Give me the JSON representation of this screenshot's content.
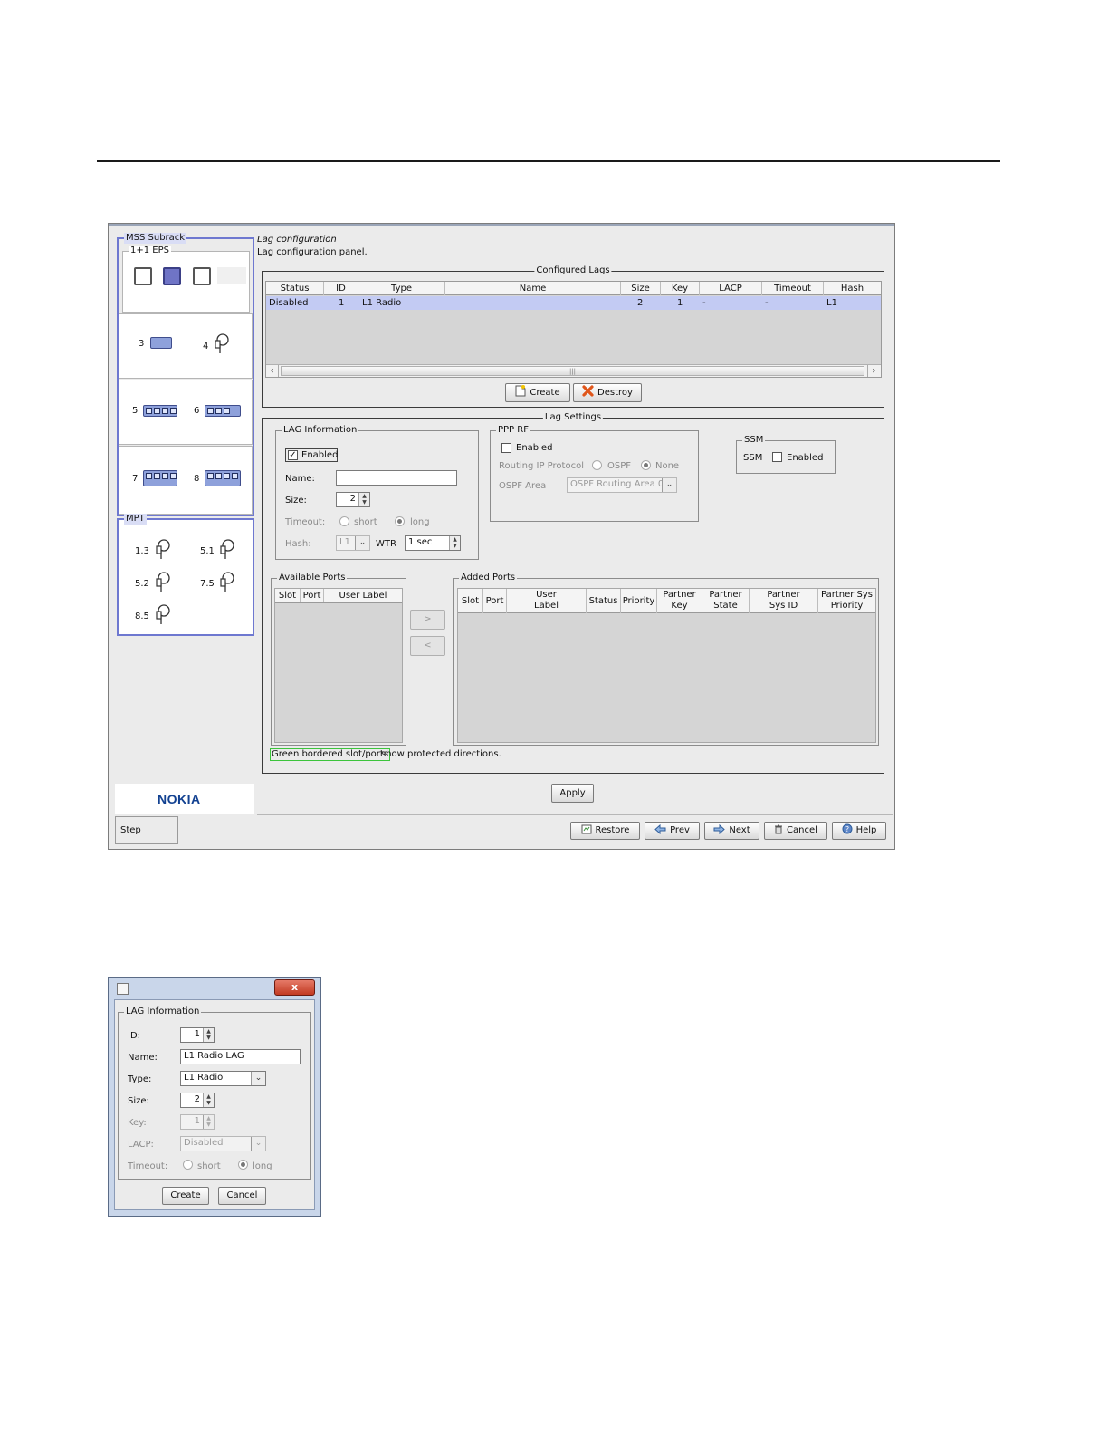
{
  "main_window": {
    "subrack": {
      "title": "MSS Subrack",
      "eps_title": "1+1 EPS",
      "slots_row1": [
        "3",
        "4"
      ],
      "slots_row2": [
        "5",
        "6"
      ],
      "slots_row3": [
        "7",
        "8"
      ]
    },
    "mpt": {
      "title": "MPT",
      "items": [
        "1.3",
        "5.1",
        "5.2",
        "7.5",
        "8.5"
      ]
    },
    "brand": "NOKIA",
    "step_label": "Step",
    "header": {
      "title": "Lag configuration",
      "subtitle": "Lag configuration panel."
    },
    "configured_lags": {
      "title": "Configured Lags",
      "columns": [
        "Status",
        "ID",
        "Type",
        "Name",
        "Size",
        "Key",
        "LACP",
        "Timeout",
        "Hash"
      ],
      "rows": [
        {
          "status": "Disabled",
          "id": "1",
          "type": "L1 Radio",
          "name": "",
          "size": "2",
          "key": "1",
          "lacp": "-",
          "timeout": "-",
          "hash": "L1"
        }
      ],
      "create_label": "Create",
      "destroy_label": "Destroy"
    },
    "lag_settings": {
      "title": "Lag Settings",
      "lag_info": {
        "title": "LAG Information",
        "enabled_label": "Enabled",
        "enabled": true,
        "name_label": "Name:",
        "name_value": "",
        "size_label": "Size:",
        "size_value": "2",
        "timeout_label": "Timeout:",
        "timeout_short": "short",
        "timeout_long": "long",
        "hash_label": "Hash:",
        "hash_value": "L1",
        "wtr_label": "WTR",
        "wtr_value": "1 sec"
      },
      "ppp_rf": {
        "title": "PPP RF",
        "enabled_label": "Enabled",
        "routing_label": "Routing IP Protocol",
        "ospf_label": "OSPF",
        "none_label": "None",
        "area_label": "OSPF Area",
        "area_value": "OSPF Routing Area 0"
      },
      "ssm": {
        "title": "SSM",
        "ssm_label": "SSM",
        "enabled_label": "Enabled"
      },
      "available_ports": {
        "title": "Available Ports",
        "columns": [
          "Slot",
          "Port",
          "User Label"
        ]
      },
      "move_right": ">",
      "move_left": "<",
      "added_ports": {
        "title": "Added Ports",
        "columns": [
          "Slot",
          "Port",
          "User Label",
          "Status",
          "Priority",
          "Partner Key",
          "Partner State",
          "Partner Sys ID",
          "Partner Sys Priority"
        ]
      },
      "note_boxed": "Green bordered slot/ports",
      "note_rest": " show protected directions."
    },
    "apply_label": "Apply",
    "footer_buttons": {
      "restore": "Restore",
      "prev": "Prev",
      "next": "Next",
      "cancel": "Cancel",
      "help": "Help"
    }
  },
  "dialog": {
    "close_glyph": "x",
    "group_title": "LAG Information",
    "id_label": "ID:",
    "id_value": "1",
    "name_label": "Name:",
    "name_value": "L1 Radio LAG",
    "type_label": "Type:",
    "type_value": "L1 Radio",
    "size_label": "Size:",
    "size_value": "2",
    "key_label": "Key:",
    "key_value": "1",
    "lacp_label": "LACP:",
    "lacp_value": "Disabled",
    "timeout_label": "Timeout:",
    "timeout_short": "short",
    "timeout_long": "long",
    "create_label": "Create",
    "cancel_label": "Cancel"
  },
  "colors": {
    "selection_row": "#c3cbf3",
    "subrack_border": "#6e78d0",
    "protected_note_border": "#3cc43c",
    "brand_blue": "#124191"
  }
}
